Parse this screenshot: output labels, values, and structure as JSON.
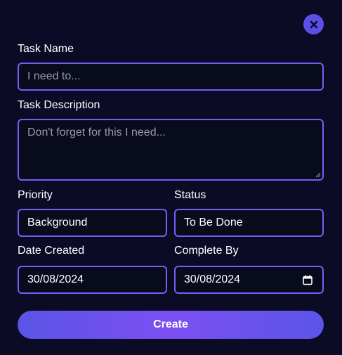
{
  "form": {
    "task_name": {
      "label": "Task Name",
      "placeholder": "I need to..."
    },
    "task_description": {
      "label": "Task Description",
      "placeholder": "Don't forget for this I need..."
    },
    "priority": {
      "label": "Priority",
      "value": "Background"
    },
    "status": {
      "label": "Status",
      "value": "To Be Done"
    },
    "date_created": {
      "label": "Date Created",
      "value": "30/08/2024"
    },
    "complete_by": {
      "label": "Complete By",
      "value": "30/08/2024"
    },
    "submit_label": "Create"
  },
  "colors": {
    "background": "#0c0b26",
    "field_background": "#080b1c",
    "field_border": "#7a5cf5",
    "accent": "#5b4fe8",
    "placeholder_text": "#9a9aa8"
  },
  "icons": {
    "close": "close-icon",
    "calendar": "calendar-icon"
  }
}
